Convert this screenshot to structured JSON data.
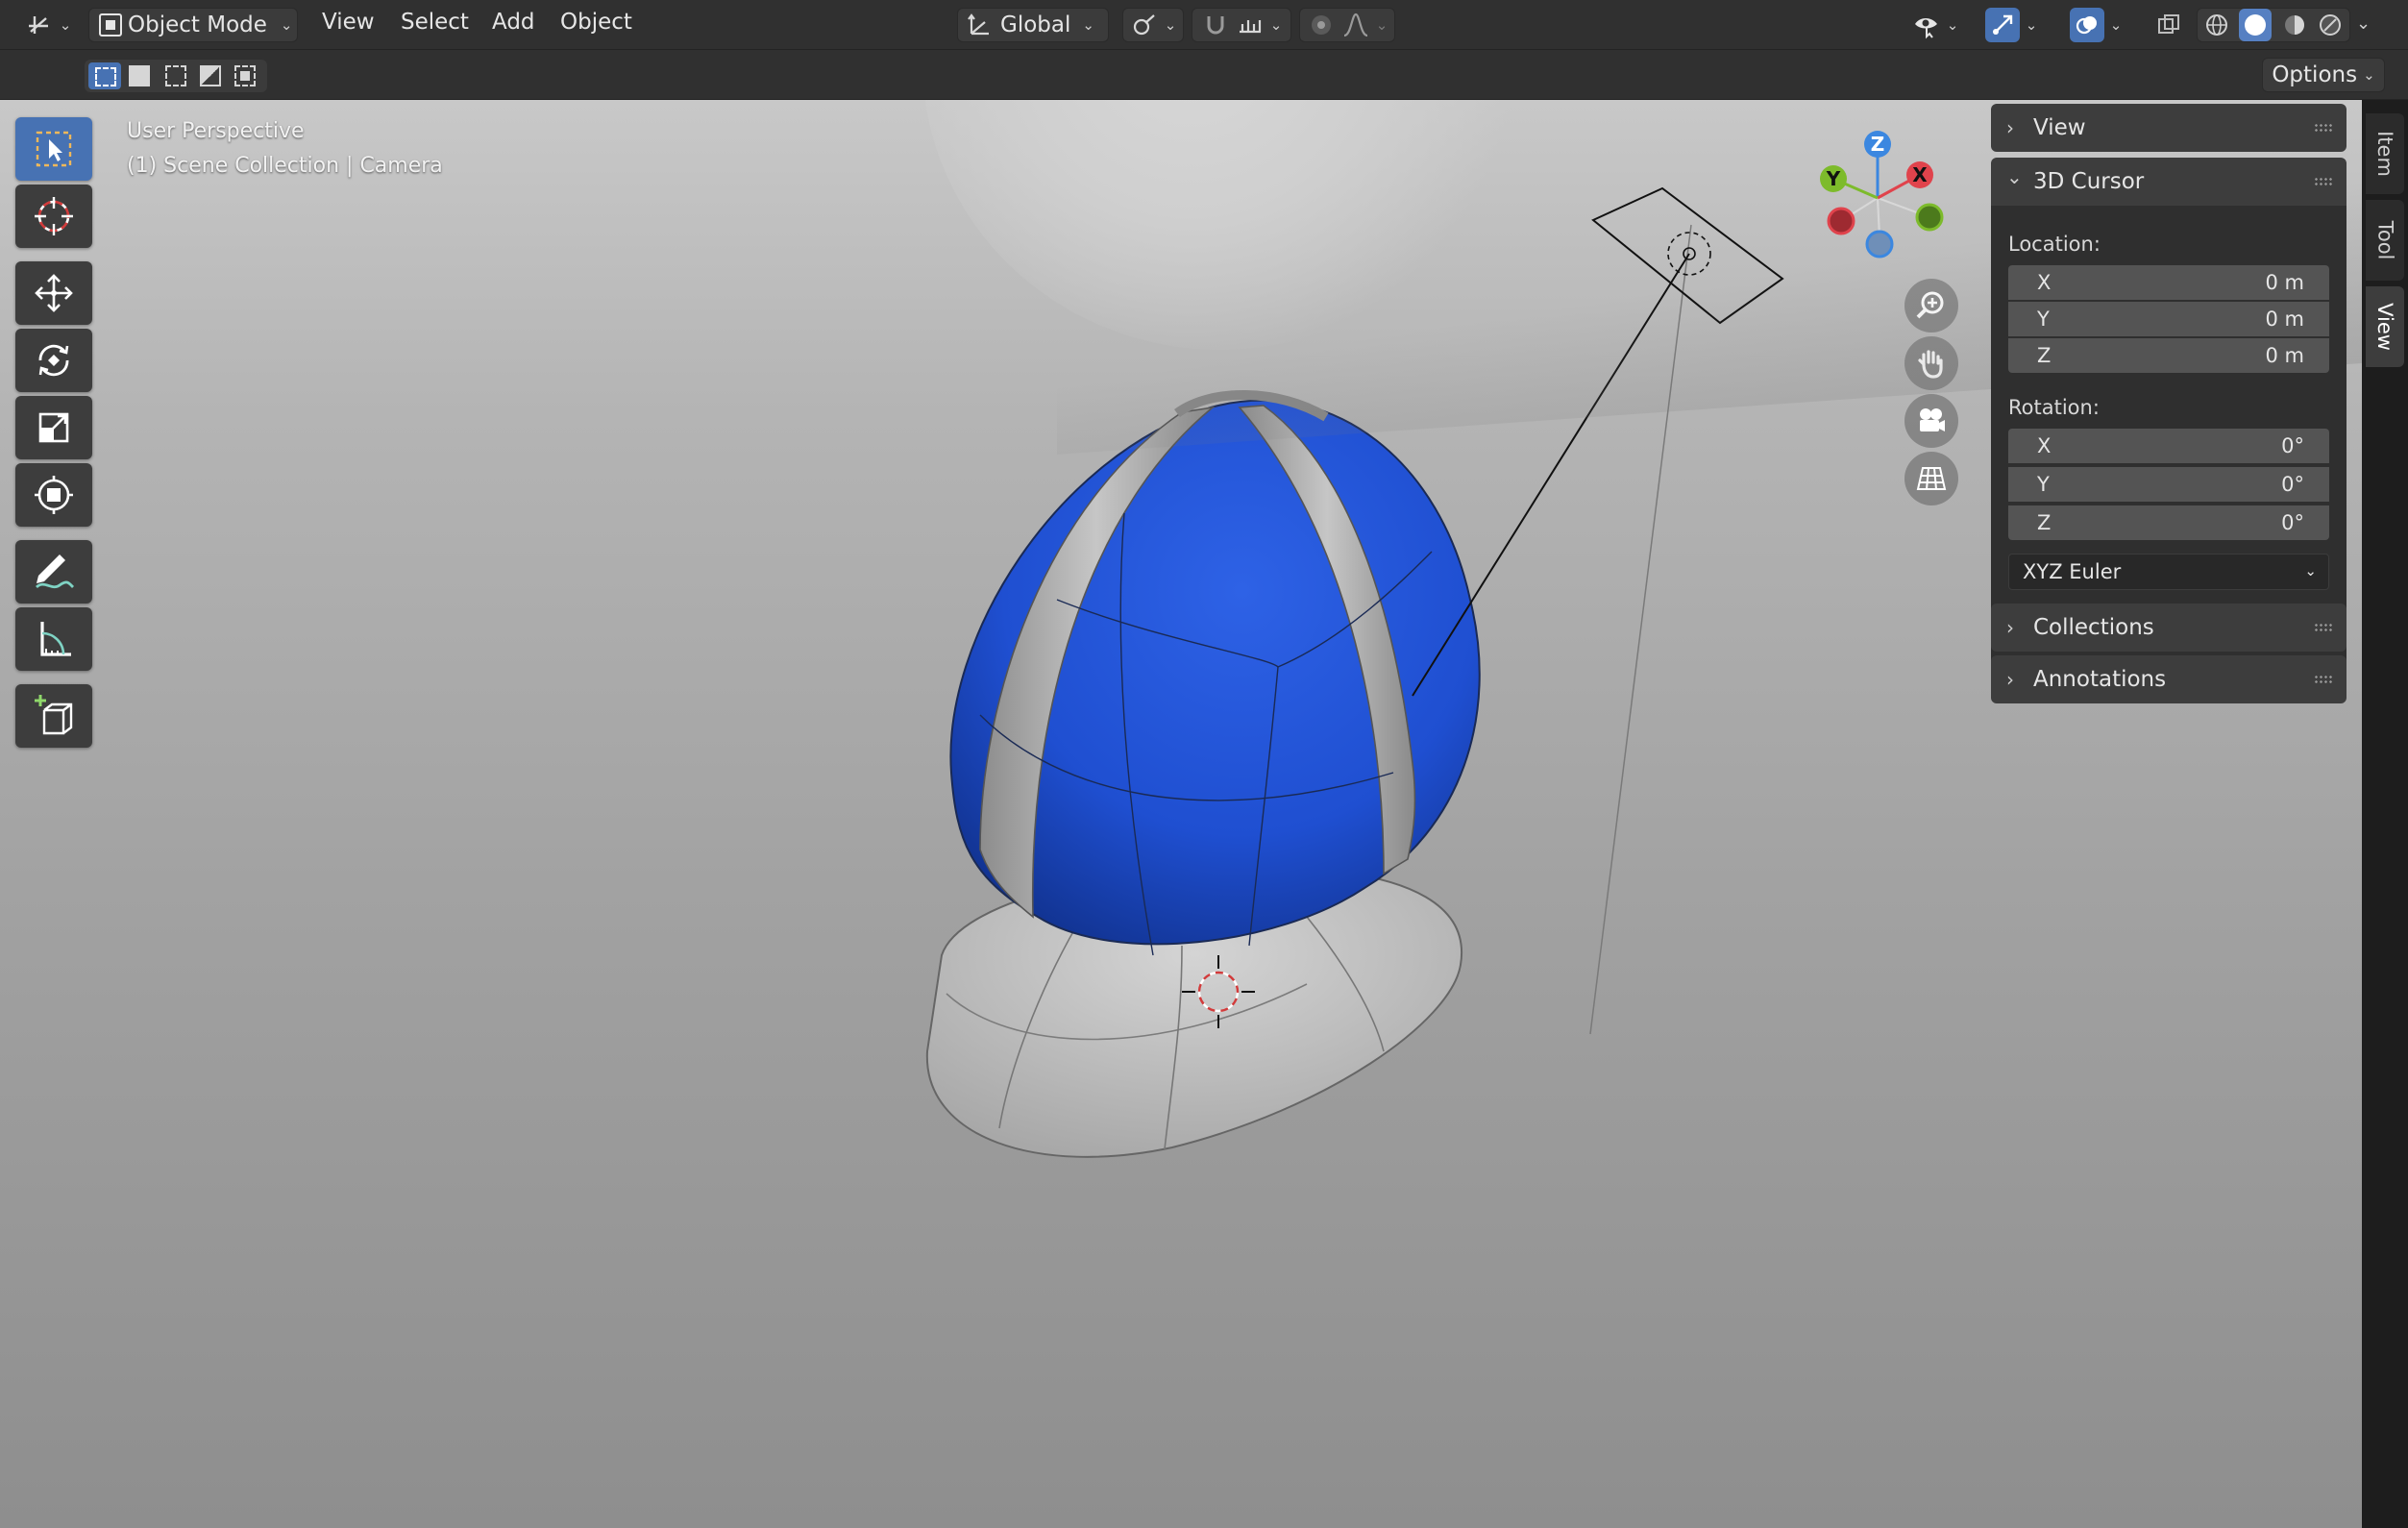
{
  "header": {
    "mode": {
      "label": "Object Mode",
      "icon": "object-mode-icon"
    },
    "menus": [
      "View",
      "Select",
      "Add",
      "Object"
    ],
    "orientation": {
      "label": "Global"
    }
  },
  "toolsettings": {
    "options_label": "Options"
  },
  "viewport": {
    "view_name": "User Perspective",
    "collection_info": "(1) Scene Collection | Camera"
  },
  "gizmo": {
    "z": "Z",
    "y": "Y",
    "x": "X"
  },
  "sidebar": {
    "view_panel": "View",
    "cursor_panel": "3D Cursor",
    "location_label": "Location:",
    "location": [
      {
        "axis": "X",
        "value": "0 m"
      },
      {
        "axis": "Y",
        "value": "0 m"
      },
      {
        "axis": "Z",
        "value": "0 m"
      }
    ],
    "rotation_label": "Rotation:",
    "rotation": [
      {
        "axis": "X",
        "value": "0°"
      },
      {
        "axis": "Y",
        "value": "0°"
      },
      {
        "axis": "Z",
        "value": "0°"
      }
    ],
    "rotation_mode": "XYZ Euler",
    "collections_panel": "Collections",
    "annotations_panel": "Annotations"
  },
  "n_tabs": [
    "Item",
    "Tool",
    "View"
  ],
  "colors": {
    "accent": "#4772b3",
    "object_blue": "#1f4fd1",
    "axis_x": "#e0434c",
    "axis_y": "#7dbb2b",
    "axis_z": "#3b87e0"
  }
}
